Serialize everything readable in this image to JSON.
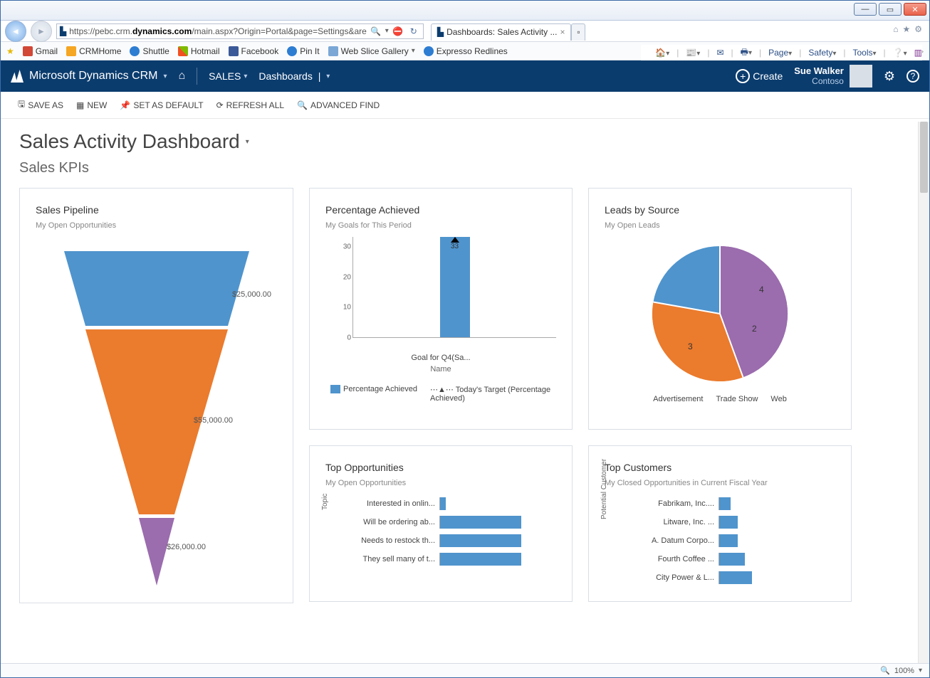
{
  "browser": {
    "url_prefix": "https://pebc.crm.",
    "url_bold": "dynamics.com",
    "url_suffix": "/main.aspx?Origin=Portal&page=Settings&are",
    "tab_title": "Dashboards: Sales Activity ...",
    "favorites": [
      "Gmail",
      "CRMHome",
      "Shuttle",
      "Hotmail",
      "Facebook",
      "Pin It",
      "Web Slice Gallery",
      "Expresso Redlines"
    ],
    "cmdbar": {
      "page": "Page",
      "safety": "Safety",
      "tools": "Tools"
    },
    "zoom": "100%"
  },
  "crm": {
    "brand": "Microsoft Dynamics CRM",
    "nav1": "SALES",
    "nav2": "Dashboards",
    "create": "Create",
    "user_name": "Sue Walker",
    "user_org": "Contoso"
  },
  "toolbar": {
    "save_as": "SAVE AS",
    "new": "NEW",
    "set_default": "SET AS DEFAULT",
    "refresh": "REFRESH ALL",
    "adv_find": "ADVANCED FIND"
  },
  "page_title": "Sales Activity Dashboard",
  "section_title": "Sales KPIs",
  "cards": {
    "funnel": {
      "title": "Sales Pipeline",
      "sub": "My Open Opportunities"
    },
    "perc": {
      "title": "Percentage Achieved",
      "sub": "My Goals for This Period",
      "x_cat": "Goal for Q4(Sa...",
      "x_axis": "Name",
      "legend1": "Percentage Achieved",
      "legend2": "Today's Target (Percentage Achieved)"
    },
    "pie": {
      "title": "Leads by Source",
      "sub": "My Open Leads",
      "legend": [
        "Advertisement",
        "Trade Show",
        "Web"
      ]
    },
    "topopp": {
      "title": "Top Opportunities",
      "sub": "My Open Opportunities",
      "ylabel": "Topic"
    },
    "topcust": {
      "title": "Top Customers",
      "sub": "My Closed Opportunities in Current Fiscal Year",
      "ylabel": "Potential Customer"
    }
  },
  "chart_data": [
    {
      "type": "funnel",
      "title": "Sales Pipeline",
      "series": [
        {
          "label": "$25,000.00",
          "value": 25000,
          "color": "#4f94cd"
        },
        {
          "label": "$55,000.00",
          "value": 55000,
          "color": "#eb7b2d"
        },
        {
          "label": "$26,000.00",
          "value": 26000,
          "color": "#9b6cae"
        }
      ]
    },
    {
      "type": "bar",
      "title": "Percentage Achieved",
      "xlabel": "Name",
      "categories": [
        "Goal for Q4(Sa..."
      ],
      "values": [
        33
      ],
      "ylim": [
        0,
        33
      ],
      "yticks": [
        0,
        10,
        20,
        30
      ]
    },
    {
      "type": "pie",
      "title": "Leads by Source",
      "series": [
        {
          "name": "Advertisement",
          "value": 2,
          "color": "#4f94cd"
        },
        {
          "name": "Trade Show",
          "value": 3,
          "color": "#eb7b2d"
        },
        {
          "name": "Web",
          "value": 4,
          "color": "#9b6cae"
        }
      ]
    },
    {
      "type": "bar",
      "orientation": "horizontal",
      "title": "Top Opportunities",
      "ylabel": "Topic",
      "categories": [
        "Interested in onlin...",
        "Will be ordering ab...",
        "Needs to restock th...",
        "They sell many of t..."
      ],
      "values": [
        5,
        70,
        70,
        70
      ]
    },
    {
      "type": "bar",
      "orientation": "horizontal",
      "title": "Top Customers",
      "ylabel": "Potential Customer",
      "categories": [
        "Fabrikam, Inc....",
        "Litware, Inc. ...",
        "A. Datum Corpo...",
        "Fourth Coffee ...",
        "City Power & L..."
      ],
      "values": [
        10,
        16,
        16,
        22,
        28
      ]
    }
  ]
}
